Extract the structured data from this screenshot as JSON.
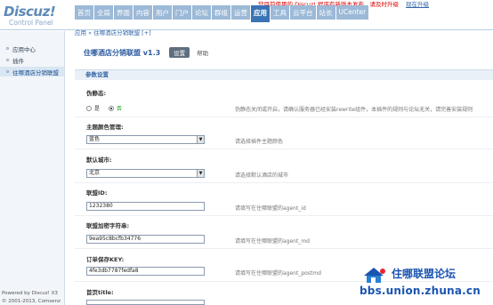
{
  "header": {
    "logo": "Discuz!",
    "logo_sub": "Control Panel",
    "notice": "您目前使用的 Discuz! 程序有新版本发布，请及时升级",
    "notice_link": "现在升级",
    "nav": [
      "首页",
      "全局",
      "界面",
      "内容",
      "用户",
      "门户",
      "论坛",
      "群组",
      "运营",
      "应用",
      "工具",
      "云平台",
      "站长",
      "UCenter"
    ],
    "active_nav": "应用"
  },
  "breadcrumb": "应用 » 住哪酒店分销联盟 [+]",
  "sidebar": {
    "items": [
      {
        "label": "应用中心"
      },
      {
        "label": "插件"
      },
      {
        "label": "住哪酒店分销联盟"
      }
    ],
    "footer_1": "Powered by Discuz! X3",
    "footer_2": "© 2001-2013, Comsenz Inc."
  },
  "page": {
    "title": "住哪酒店分销联盟 v1.3",
    "btn_set": "设置",
    "btn_help": "帮助",
    "section": "参数设置"
  },
  "fields": {
    "rewrite": {
      "label": "伪静态:",
      "opt_yes": "是",
      "opt_no": "否",
      "hint": "伪静态关闭或开启，请确认服务器已经安装rewrite组件，本插件的规则与论坛无关，请完善安装规则"
    },
    "color": {
      "label": "主题颜色管理:",
      "value": "蓝色",
      "hint": "请选择插件主题颜色"
    },
    "city": {
      "label": "默认城市:",
      "value": "北京",
      "hint": "请选择默认酒店的城市"
    },
    "agent_id": {
      "label": "联盟ID:",
      "value": "1232380",
      "hint": "请填写在住哪联盟的agent_id"
    },
    "agent_md": {
      "label": "联盟加密字符串:",
      "value": "9ea95c8bcfb34776",
      "hint": "请填写在住哪联盟的agent_md"
    },
    "postmd": {
      "label": "订单保存KEY:",
      "value": "4fe3db7787fedfa8",
      "hint": "请填写在住哪联盟的agent_postmd"
    },
    "home_title": {
      "label": "首页title:"
    }
  },
  "watermark": {
    "title": "住哪联盟论坛",
    "url": "bbs.union.zhuna.cn"
  }
}
